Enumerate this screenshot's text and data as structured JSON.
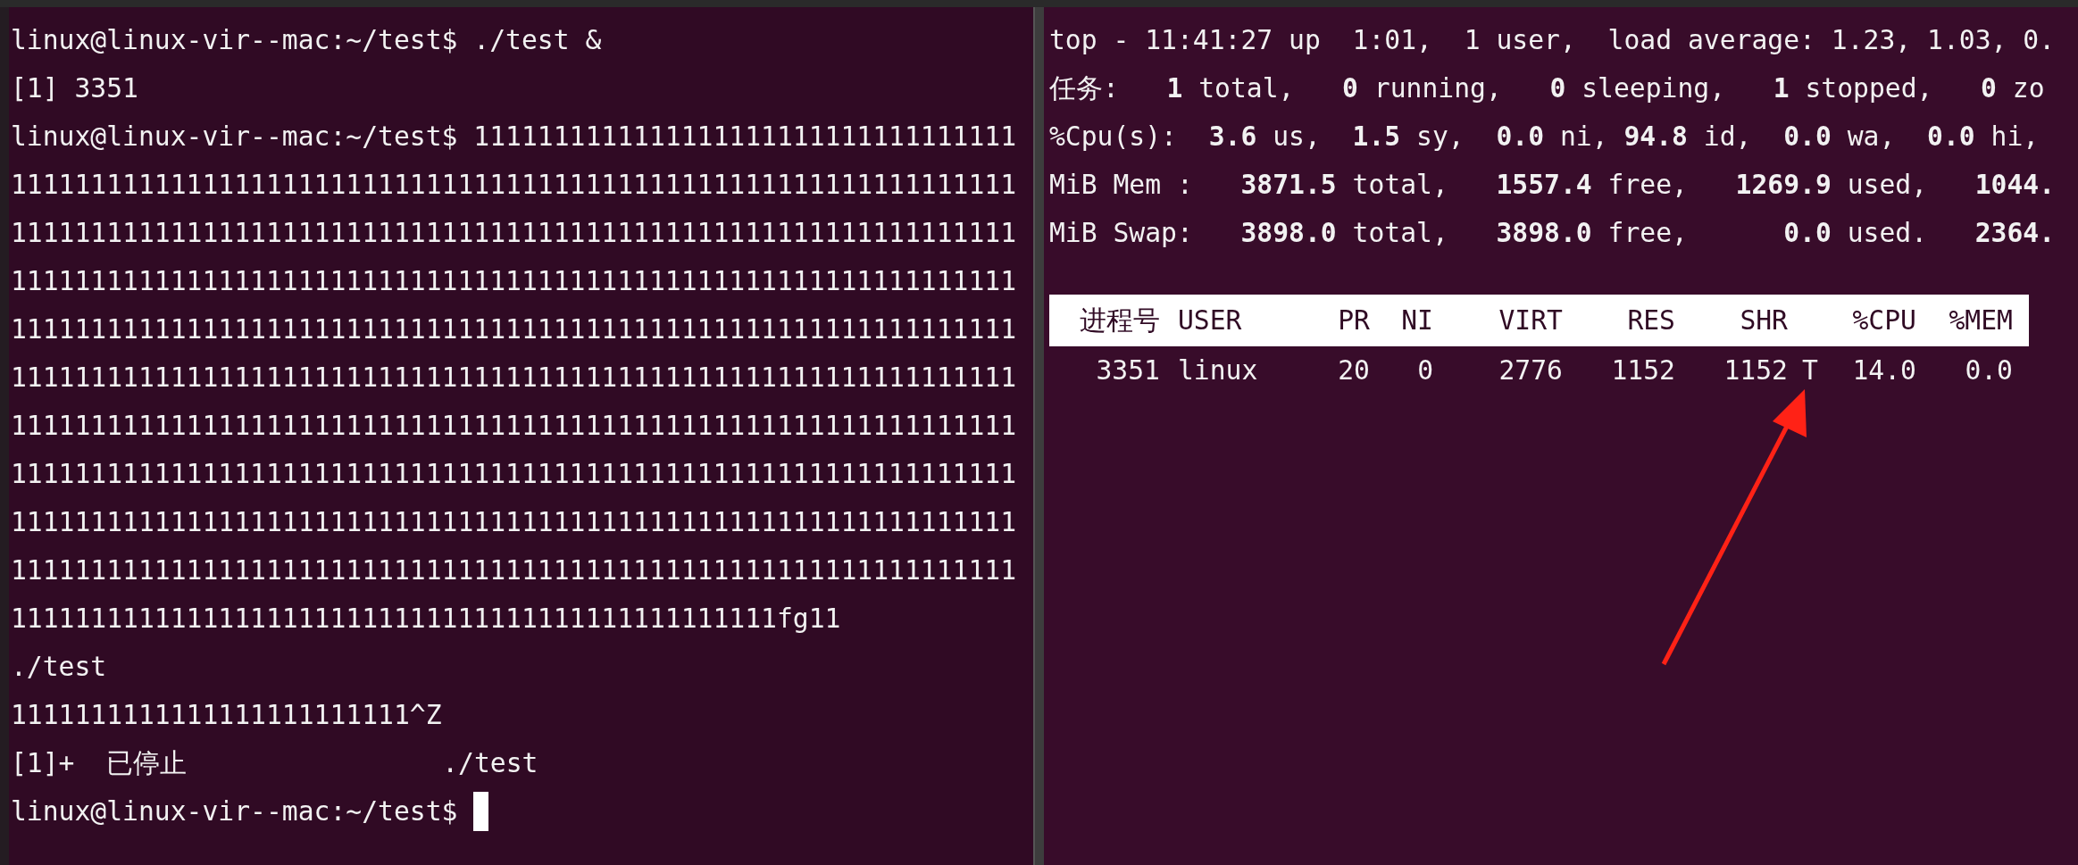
{
  "left_terminal": {
    "lines": [
      "linux@linux-vir--mac:~/test$ ./test &",
      "[1] 3351",
      "linux@linux-vir--mac:~/test$ 1111111111111111111111111111111111",
      "111111111111111111111111111111111111111111111111111111111111111",
      "111111111111111111111111111111111111111111111111111111111111111",
      "111111111111111111111111111111111111111111111111111111111111111",
      "111111111111111111111111111111111111111111111111111111111111111",
      "111111111111111111111111111111111111111111111111111111111111111",
      "111111111111111111111111111111111111111111111111111111111111111",
      "111111111111111111111111111111111111111111111111111111111111111",
      "111111111111111111111111111111111111111111111111111111111111111",
      "111111111111111111111111111111111111111111111111111111111111111",
      "111111111111111111111111111111111111111111111111fg11",
      "./test",
      "1111111111111111111111111^Z",
      "[1]+  已停止                ./test"
    ],
    "prompt": "linux@linux-vir--mac:~/test$"
  },
  "right_terminal": {
    "summary": [
      "top - 11:41:27 up  1:01,  1 user,  load average: 1.23, 1.03, 0.",
      "任务:   **1** total,   **0** running,   **0** sleeping,   **1** stopped,   **0** zo",
      "%Cpu(s):  **3.6** us,  **1.5** sy,  **0.0** ni, **94.8** id,  **0.0** wa,  **0.0** hi,",
      "MiB Mem :   **3871.5** total,   **1557.4** free,   **1269.9** used,   **1044.**",
      "MiB Swap:   **3898.0** total,   **3898.0** free,      **0.0** used.   **2364.**"
    ],
    "table": {
      "columns": [
        "进程号",
        "USER",
        "PR",
        "NI",
        "VIRT",
        "RES",
        "SHR",
        "",
        "%CPU",
        "%MEM"
      ],
      "rows": [
        {
          "cells": [
            "3351",
            "linux",
            "20",
            "0",
            "2776",
            "1152",
            "1152",
            "T",
            "14.0",
            "0.0"
          ]
        }
      ]
    }
  }
}
